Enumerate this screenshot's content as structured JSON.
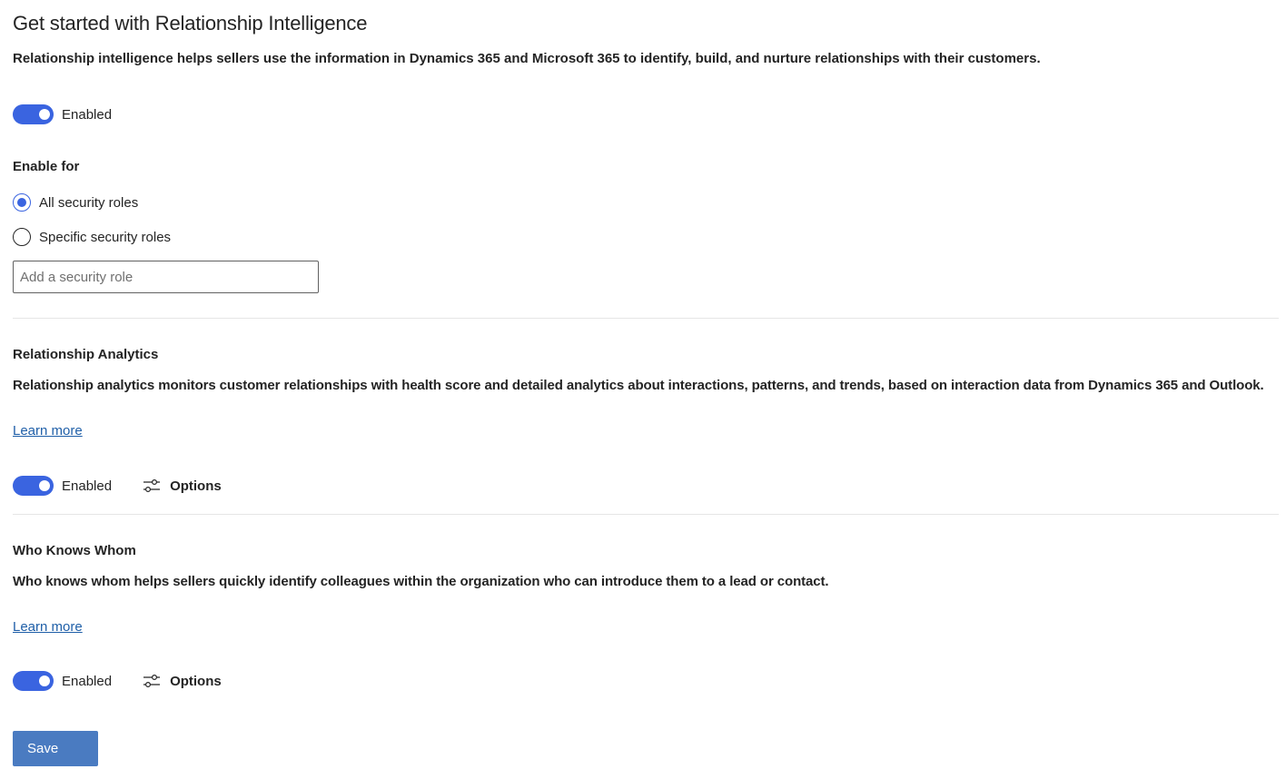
{
  "header": {
    "title": "Get started with Relationship Intelligence",
    "description": "Relationship intelligence helps sellers use the information in Dynamics 365 and Microsoft 365 to identify, build, and nurture relationships with their customers."
  },
  "main_toggle": {
    "label": "Enabled",
    "on": true
  },
  "enable_for": {
    "label": "Enable for",
    "options": [
      {
        "label": "All security roles",
        "selected": true
      },
      {
        "label": "Specific security roles",
        "selected": false
      }
    ],
    "role_input": {
      "value": "",
      "placeholder": "Add a security role"
    }
  },
  "relationship_analytics": {
    "title": "Relationship Analytics",
    "description": "Relationship analytics monitors customer relationships with health score and detailed analytics about interactions, patterns, and trends, based on interaction data from Dynamics 365 and Outlook.",
    "learn_more": "Learn more",
    "toggle_label": "Enabled",
    "toggle_on": true,
    "options_label": "Options"
  },
  "who_knows_whom": {
    "title": "Who Knows Whom",
    "description": "Who knows whom helps sellers quickly identify colleagues within the organization who can introduce them to a lead or contact.",
    "learn_more": "Learn more",
    "toggle_label": "Enabled",
    "toggle_on": true,
    "options_label": "Options"
  },
  "footer": {
    "save_label": "Save"
  },
  "colors": {
    "accent": "#3a64e0",
    "link": "#1f5fa8",
    "save_button": "#4a7bc1"
  },
  "icons": {
    "options": "sliders-icon"
  }
}
